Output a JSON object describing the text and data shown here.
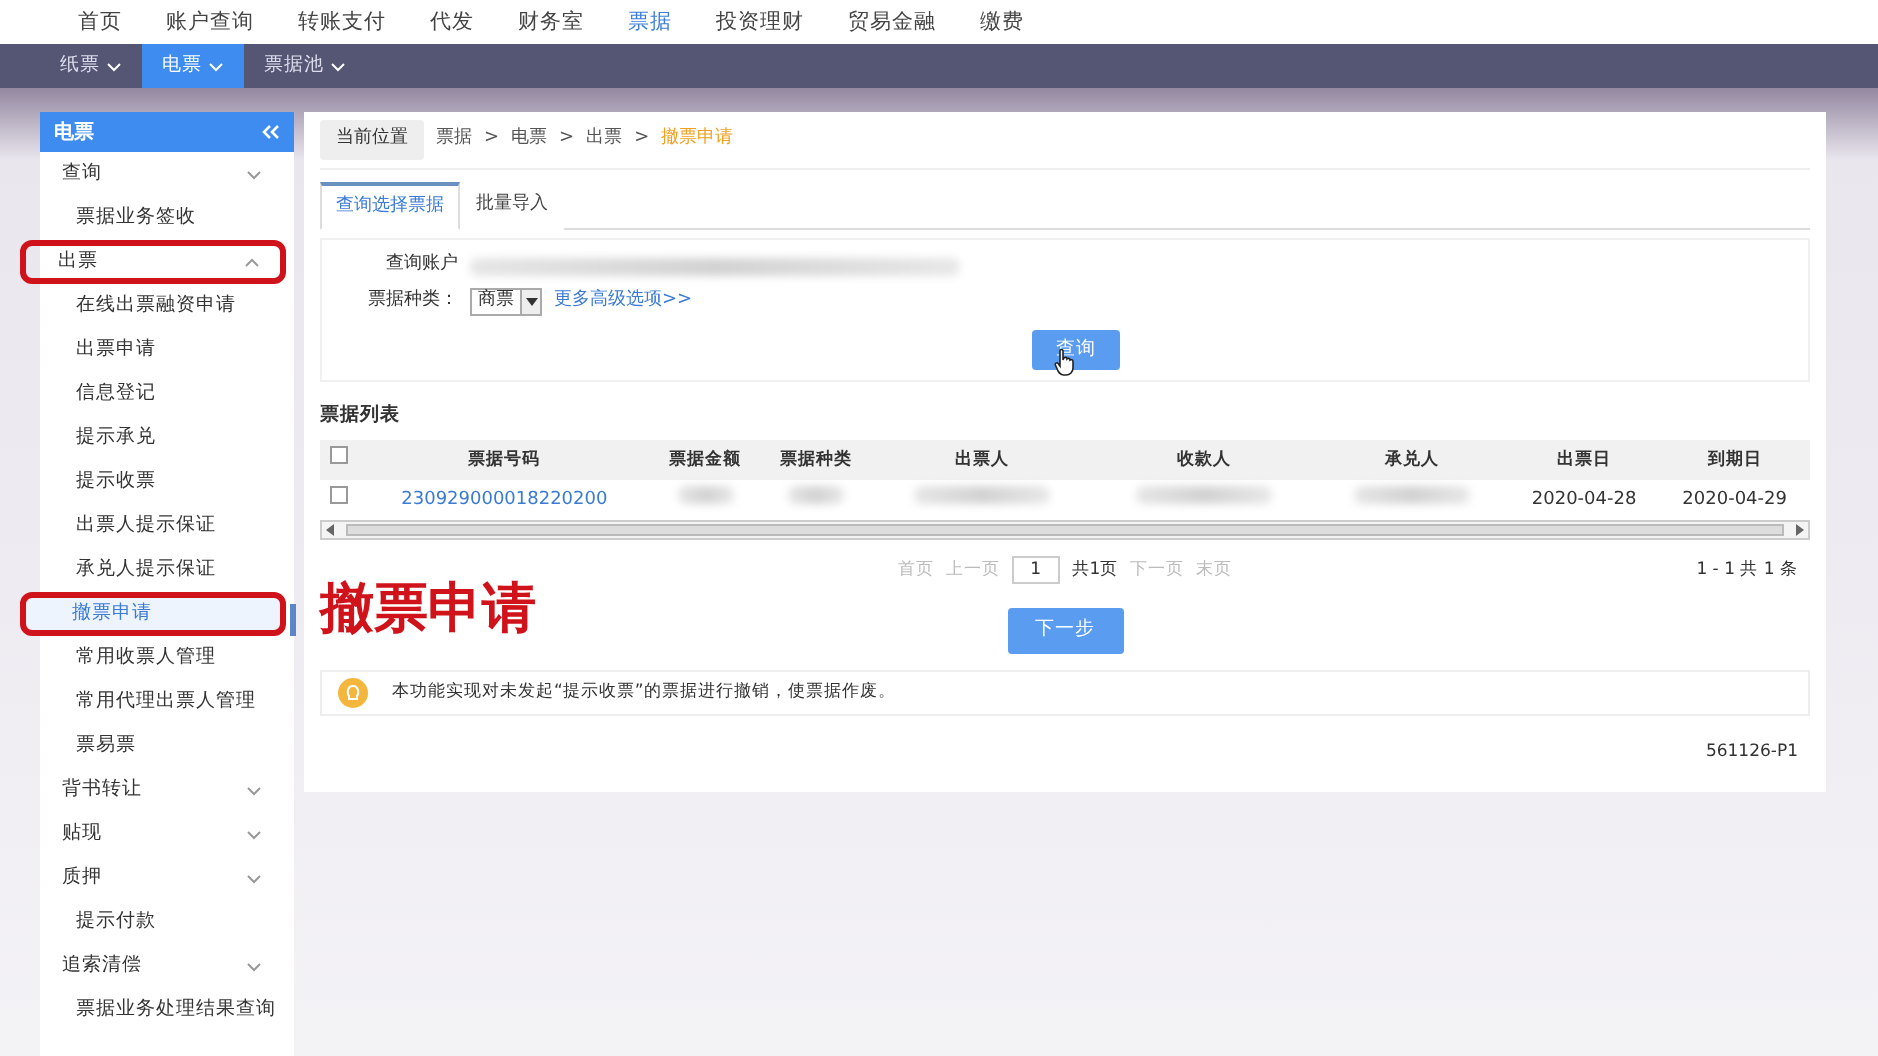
{
  "top_nav": [
    {
      "label": "首页",
      "selected": false
    },
    {
      "label": "账户查询",
      "selected": false
    },
    {
      "label": "转账支付",
      "selected": false
    },
    {
      "label": "代发",
      "selected": false
    },
    {
      "label": "财务室",
      "selected": false
    },
    {
      "label": "票据",
      "selected": true
    },
    {
      "label": "投资理财",
      "selected": false
    },
    {
      "label": "贸易金融",
      "selected": false
    },
    {
      "label": "缴费",
      "selected": false
    }
  ],
  "sub_nav": [
    {
      "label": "纸票",
      "selected": false
    },
    {
      "label": "电票",
      "selected": true
    },
    {
      "label": "票据池",
      "selected": false
    }
  ],
  "sidebar": {
    "title": "电票",
    "items": [
      {
        "label": "查询",
        "kind": "group",
        "expanded": false,
        "highlighted": false
      },
      {
        "label": "票据业务签收",
        "kind": "link",
        "highlighted": false
      },
      {
        "label": "出票",
        "kind": "group",
        "expanded": true,
        "highlighted": true,
        "children": [
          {
            "label": "在线出票融资申请",
            "selected": false,
            "highlighted": false
          },
          {
            "label": "出票申请",
            "selected": false,
            "highlighted": false
          },
          {
            "label": "信息登记",
            "selected": false,
            "highlighted": false
          },
          {
            "label": "提示承兑",
            "selected": false,
            "highlighted": false
          },
          {
            "label": "提示收票",
            "selected": false,
            "highlighted": false
          },
          {
            "label": "出票人提示保证",
            "selected": false,
            "highlighted": false
          },
          {
            "label": "承兑人提示保证",
            "selected": false,
            "highlighted": false
          },
          {
            "label": "撤票申请",
            "selected": true,
            "highlighted": true
          },
          {
            "label": "常用收票人管理",
            "selected": false,
            "highlighted": false
          },
          {
            "label": "常用代理出票人管理",
            "selected": false,
            "highlighted": false
          }
        ]
      },
      {
        "label": "票易票",
        "kind": "link",
        "highlighted": false
      },
      {
        "label": "背书转让",
        "kind": "group",
        "expanded": false,
        "highlighted": false
      },
      {
        "label": "贴现",
        "kind": "group",
        "expanded": false,
        "highlighted": false
      },
      {
        "label": "质押",
        "kind": "group",
        "expanded": false,
        "highlighted": false
      },
      {
        "label": "提示付款",
        "kind": "link",
        "highlighted": false
      },
      {
        "label": "追索清偿",
        "kind": "group",
        "expanded": false,
        "highlighted": false
      },
      {
        "label": "票据业务处理结果查询",
        "kind": "link",
        "highlighted": false
      }
    ]
  },
  "breadcrumb": {
    "label": "当前位置",
    "path": [
      "票据",
      "电票",
      "出票",
      "撤票申请"
    ],
    "separator": ">"
  },
  "tabs": [
    {
      "label": "查询选择票据",
      "selected": true
    },
    {
      "label": "批量导入",
      "selected": false
    }
  ],
  "form": {
    "account_label": "查询账户",
    "type_label": "票据种类：",
    "type_value": "商票",
    "more_link": "更多高级选项>>",
    "query_button": "查询"
  },
  "list": {
    "title": "票据列表",
    "select_all_checked": false,
    "columns": [
      "票据号码",
      "票据金额",
      "票据种类",
      "出票人",
      "收款人",
      "承兑人",
      "出票日",
      "到期日"
    ],
    "rows": [
      {
        "checked": false,
        "cells": [
          "230929000018220200",
          null,
          null,
          null,
          null,
          null,
          "2020-04-28",
          "2020-04-29"
        ]
      }
    ]
  },
  "pagination": {
    "first": "首页",
    "prev": "上一页",
    "page": "1",
    "total_pages": "共1页",
    "next": "下一页",
    "last": "末页",
    "disabled": true,
    "summary": "1 - 1  共 1 条"
  },
  "overlay_caption": "撤票申请",
  "next_button": "下一步",
  "notice": "本功能实现对未发起“提示收票”的票据进行撤销，使票据作废。",
  "page_code": "561126-P1"
}
